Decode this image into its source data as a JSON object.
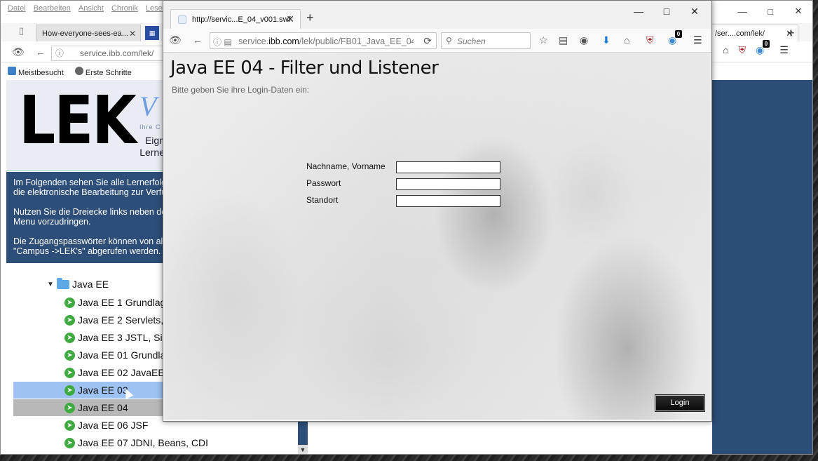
{
  "background_browser": {
    "menu": [
      "Datei",
      "Bearbeiten",
      "Ansicht",
      "Chronik",
      "Lesez"
    ],
    "tab_title": "How-everyone-sees-ea...",
    "tab_right_title": "/ser....com/lek/",
    "url": "service.ibb.com/lek/",
    "bookmarks": [
      "Meistbesucht",
      "Erste Schritte"
    ],
    "badge_count": "0"
  },
  "lek_page": {
    "logo": "LEK",
    "logo_accent": "V",
    "logo_small": "Ihre C",
    "logo_sub_lines": [
      "Eign",
      "Lerne"
    ],
    "info_paragraphs": [
      [
        "Im Folgenden sehen Sie alle Lernerfolg",
        "die elektronische Bearbeitung zur Verfü"
      ],
      [
        "Nutzen Sie die Dreiecke links neben de",
        "Menu vorzudringen."
      ],
      [
        "Die Zugangspasswörter können von al",
        "\"Campus ->LEK's\" abgerufen werden."
      ]
    ],
    "tree_root": "Java EE",
    "tree_items": [
      "Java EE 1 Grundlag",
      "Java EE 2 Servlets,",
      "Java EE 3 JSTL, Sic",
      "Java EE 01 Grundla",
      "Java EE 02 JavaEE",
      "Java EE 03",
      "Java EE 04",
      "Java EE 06 JSF",
      "Java EE 07 JDNI, Beans, CDI"
    ]
  },
  "foreground_browser": {
    "tab_title": "http://servic...E_04_v001.swf",
    "url_prefix": "service.",
    "url_host": "ibb.com",
    "url_rest": "/lek/public/FB01_Java_EE_04_",
    "search_placeholder": "Suchen",
    "badge_count": "0"
  },
  "app": {
    "title": "Java EE 04 - Filter und Listener",
    "subtitle": "Bitte geben Sie ihre Login-Daten ein:",
    "fields": {
      "name_label": "Nachname, Vorname",
      "password_label": "Passwort",
      "location_label": "Standort"
    },
    "login_label": "Login"
  }
}
